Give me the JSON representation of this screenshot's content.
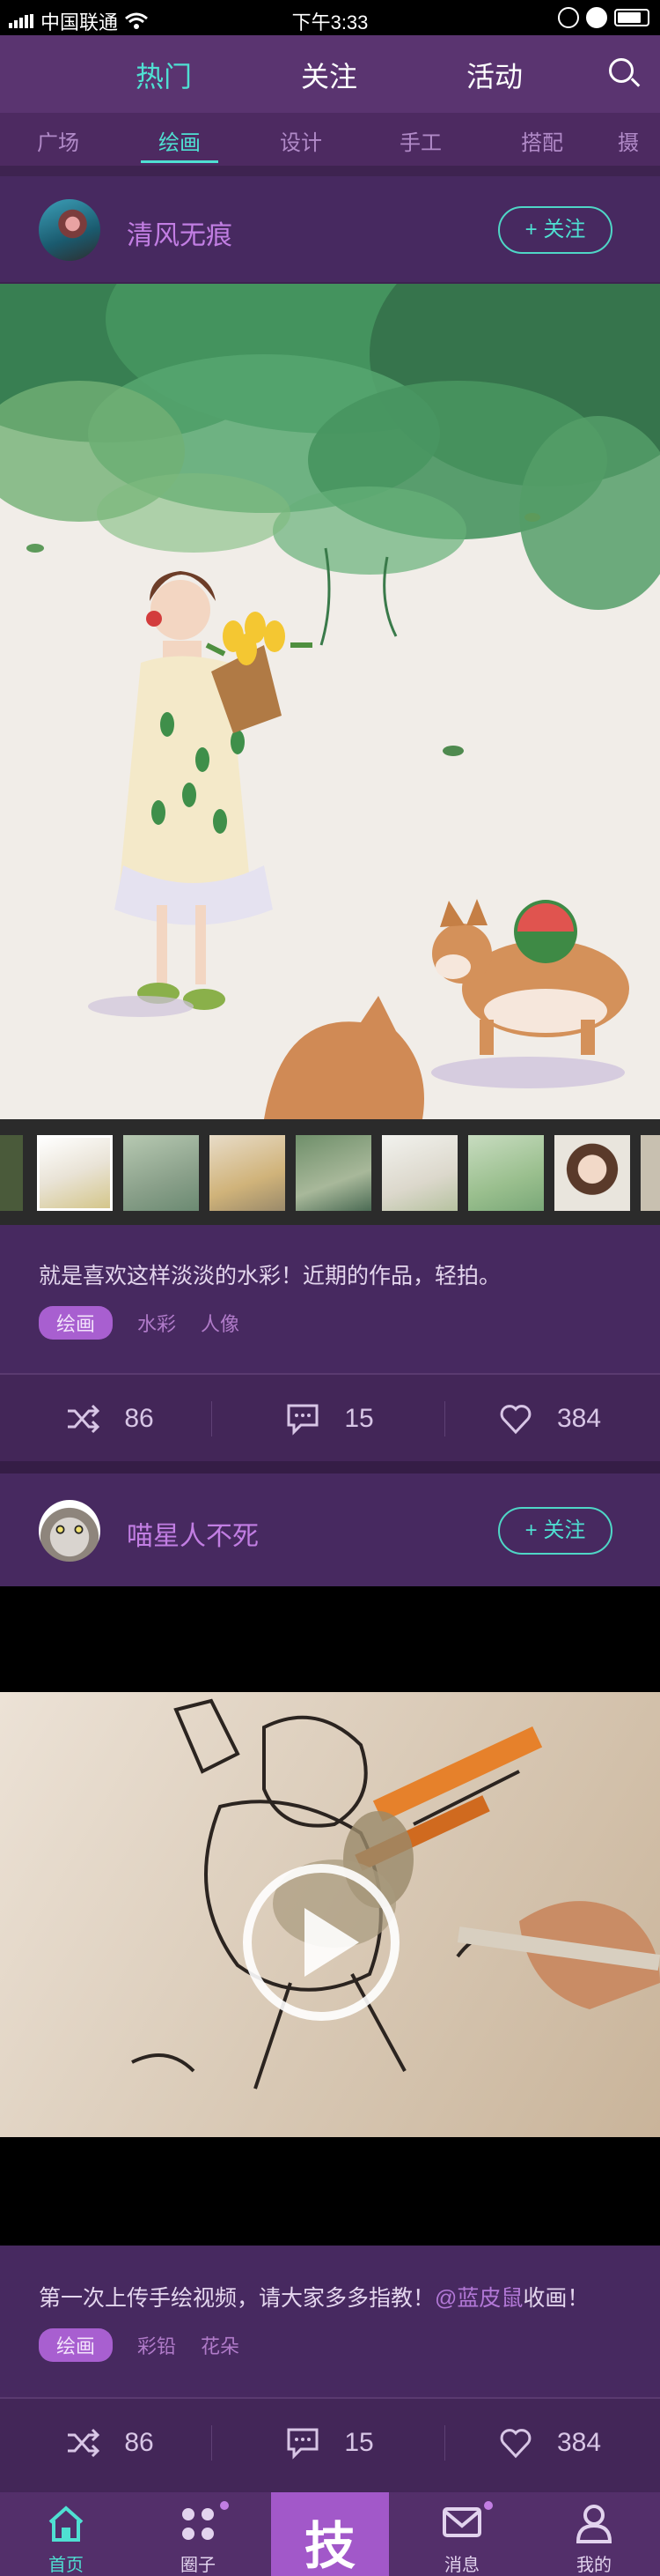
{
  "status_bar": {
    "carrier": "中国联通",
    "time": "下午3:33"
  },
  "top_nav": {
    "tabs": [
      "热门",
      "关注",
      "活动"
    ],
    "active_tab": "热门",
    "search_icon": "search-icon"
  },
  "sub_nav": {
    "tabs": [
      "广场",
      "绘画",
      "设计",
      "手工",
      "搭配",
      "摄"
    ],
    "active_tab": "绘画"
  },
  "posts": [
    {
      "username": "清风无痕",
      "follow_label": "+ 关注",
      "text": "就是喜欢这样淡淡的水彩！近期的作品，轻拍。",
      "tags": [
        "绘画",
        "水彩",
        "人像"
      ],
      "shares": "86",
      "comments": "15",
      "likes": "384"
    },
    {
      "username": "喵星人不死",
      "follow_label": "+ 关注",
      "text_before": "第一次上传手绘视频，请大家多多指教！",
      "mention": "@蓝皮鼠",
      "text_after": "收画！",
      "tags": [
        "绘画",
        "彩铅",
        "花朵"
      ],
      "shares": "86",
      "comments": "15",
      "likes": "384"
    }
  ],
  "bottom_nav": {
    "tabs": [
      "首页",
      "圈子",
      "",
      "消息",
      "我的"
    ],
    "center_glyph": "技",
    "active_tab": "首页"
  },
  "colors": {
    "accent": "#4fe0d2",
    "username": "#c27ee3",
    "background": "#3e2350"
  }
}
